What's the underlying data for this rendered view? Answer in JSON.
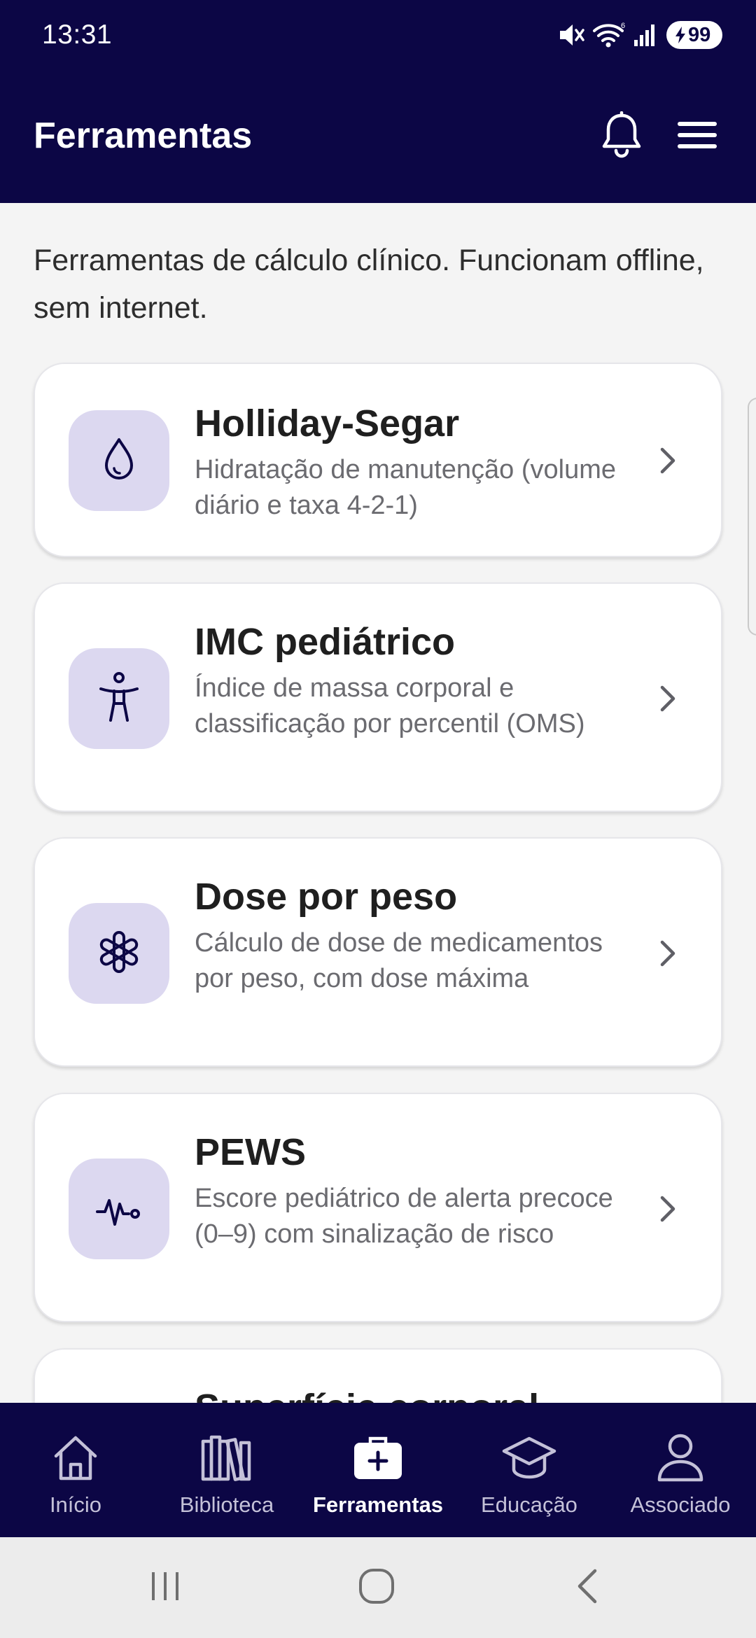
{
  "status_bar": {
    "time": "13:31",
    "battery": "99"
  },
  "app_bar": {
    "title": "Ferramentas",
    "icons": [
      "bell-icon",
      "hamburger-menu-icon"
    ]
  },
  "intro_text": "Ferramentas de cálculo clínico. Funcionam offline, sem internet.",
  "tools": [
    {
      "title": "Holliday-Segar",
      "description": "Hidratação de manutenção (volume diário e taxa 4-2-1)",
      "icon": "droplet-icon"
    },
    {
      "title": "IMC pediátrico",
      "description": "Índice de massa corporal e classificação por percentil (OMS)",
      "icon": "person-body-icon"
    },
    {
      "title": "Dose por peso",
      "description": "Cálculo de dose de medicamentos por peso, com dose máxima",
      "icon": "asterisk-medical-icon"
    },
    {
      "title": "PEWS",
      "description": "Escore pediátrico de alerta precoce (0–9) com sinalização de risco",
      "icon": "heartbeat-icon"
    },
    {
      "title": "Superfície corporal",
      "description": "",
      "icon": ""
    }
  ],
  "bottom_nav": [
    {
      "label": "Início",
      "icon": "home-icon",
      "active": false
    },
    {
      "label": "Biblioteca",
      "icon": "library-icon",
      "active": false
    },
    {
      "label": "Ferramentas",
      "icon": "medical-kit-icon",
      "active": true
    },
    {
      "label": "Educação",
      "icon": "graduation-cap-icon",
      "active": false
    },
    {
      "label": "Associado",
      "icon": "user-icon",
      "active": false
    }
  ],
  "colors": {
    "header_bg": "#0c0645",
    "icon_tile_bg": "#dcd8f0",
    "page_bg": "#f4f4f4",
    "secondary_text": "#6b6b70"
  }
}
